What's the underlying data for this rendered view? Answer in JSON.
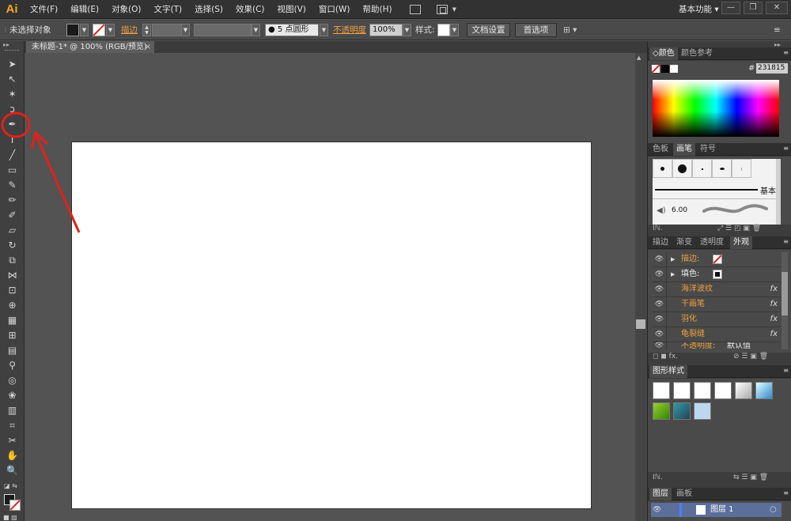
{
  "app": {
    "logo": "Ai",
    "workspace": "基本功能"
  },
  "menu": [
    "文件(F)",
    "编辑(E)",
    "对象(O)",
    "文字(T)",
    "选择(S)",
    "效果(C)",
    "视图(V)",
    "窗口(W)",
    "帮助(H)"
  ],
  "control": {
    "selection": "未选择对象",
    "stroke_label": "描边",
    "brush_value": "5 点圆形",
    "opacity_label": "不透明度",
    "opacity_value": "100%",
    "style_label": "样式",
    "doc_setup": "文档设置",
    "preferences": "首选项"
  },
  "document": {
    "tab": "未标题-1* @ 100% (RGB/预览)"
  },
  "panels": {
    "color": {
      "tab1": "颜色",
      "tab2": "颜色参考",
      "hex": "231815"
    },
    "brushes": {
      "tab1": "色板",
      "tab2": "画笔",
      "tab3": "符号",
      "basic": "基本",
      "size": "6.00"
    },
    "appearance": {
      "tabs": [
        "描边",
        "渐变",
        "透明度",
        "外观"
      ],
      "rows": [
        {
          "label": "描边:",
          "fx": false
        },
        {
          "label": "填色:",
          "fx": false
        },
        {
          "label": "海洋波纹",
          "fx": true
        },
        {
          "label": "干画笔",
          "fx": true
        },
        {
          "label": "羽化",
          "fx": true
        },
        {
          "label": "龟裂缝",
          "fx": true
        },
        {
          "label": "不透明度:",
          "value": "默认值",
          "fx": false
        }
      ],
      "fx_symbol": "fx"
    },
    "graphic_styles": {
      "tab": "图形样式"
    },
    "layers": {
      "tab1": "图层",
      "tab2": "画板",
      "layer": "图层 1"
    }
  },
  "colors": {
    "accent_orange": "#f0a040",
    "annotation_red": "#e0221a",
    "hex_field_bg": "#cfcfcf"
  }
}
